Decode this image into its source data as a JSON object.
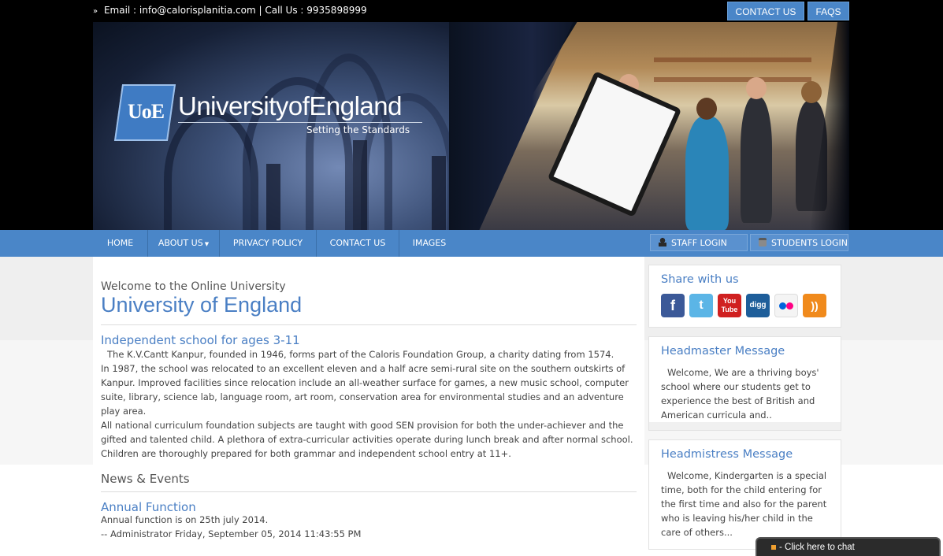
{
  "topbar": {
    "email": "Email : info@calorisplanitia.com",
    "phone": "Call Us : 9935898999",
    "contact_btn": "CONTACT US",
    "faqs_btn": "FAQS"
  },
  "logo": {
    "mark": "UoE",
    "name": "UniversityofEngland",
    "tagline": "Setting the Standards"
  },
  "nav": {
    "items": [
      {
        "label": "HOME"
      },
      {
        "label": "ABOUT US"
      },
      {
        "label": "PRIVACY POLICY"
      },
      {
        "label": "CONTACT US"
      },
      {
        "label": "IMAGES"
      }
    ],
    "staff_login": "STAFF LOGIN",
    "students_login": "STUDENTS LOGIN"
  },
  "main": {
    "welcome": "Welcome to the Online University",
    "title": "University of England",
    "section_heading": "Independent school for ages 3-11",
    "paragraphs": [
      "The K.V.Cantt Kanpur, founded in 1946, forms part of the Caloris Foundation Group, a charity dating from 1574.",
      "In 1987, the school was relocated to an excellent eleven and a half acre semi-rural site on the southern outskirts of Kanpur. Improved facilities since relocation include an all-weather surface for games, a new music school, computer suite, library, science lab, language room, art room, conservation area for environmental studies and an adventure play area.",
      "All national curriculum foundation subjects are taught with good SEN provision for both the under-achiever and the gifted and talented child. A plethora of extra-curricular activities operate during lunch break and after normal school. Children are thoroughly prepared for both grammar and independent school entry at 11+."
    ],
    "news_heading": "News & Events",
    "news_item_title": "Annual Function",
    "news_item_text": "Annual function is on 25th july 2014.",
    "news_item_meta": "-- Administrator  Friday, September 05, 2014  11:43:55 PM"
  },
  "sidebar": {
    "share_title": "Share with us",
    "social": {
      "facebook": "f",
      "twitter": "t",
      "youtube": "You Tube",
      "digg": "digg",
      "rss": "))"
    },
    "headmaster_title": "Headmaster Message",
    "headmaster_text": "Welcome, We are a thriving boys' school where our students get to experience the best of British and American curricula and..",
    "headmistress_title": "Headmistress Message",
    "headmistress_text": "Welcome, Kindergarten is a special time, both for the child entering for the first time and also for the parent who is leaving his/her child in the care of others..."
  },
  "chat": {
    "label": "- Click here to chat"
  },
  "colors": {
    "accent": "#4a86c8",
    "link": "#4a7fc4"
  }
}
